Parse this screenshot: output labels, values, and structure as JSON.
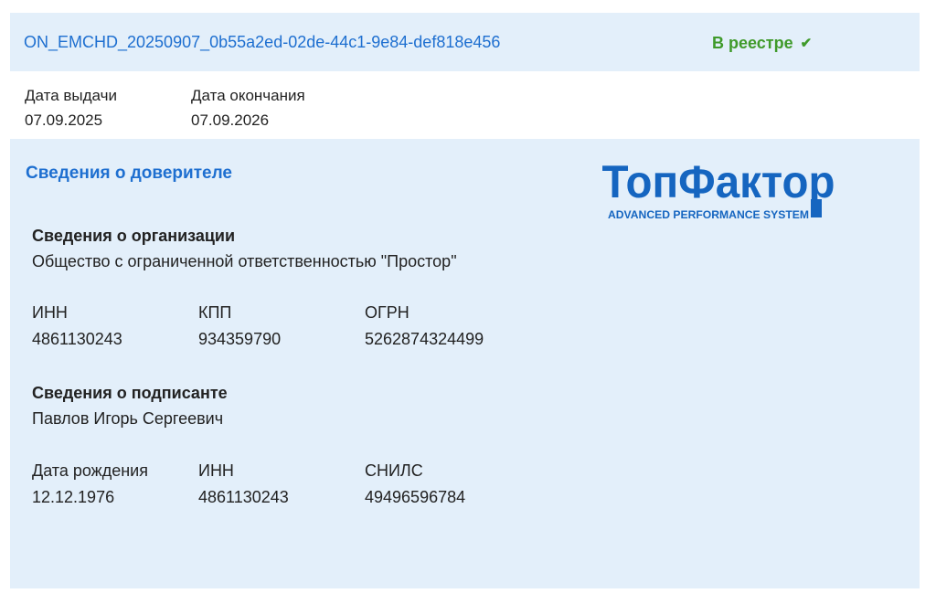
{
  "document": {
    "id": "ON_EMCHD_20250907_0b55a2ed-02de-44c1-9e84-def818e456",
    "status": "В реестре"
  },
  "dates": {
    "issue": {
      "label": "Дата выдачи",
      "value": "07.09.2025"
    },
    "expiry": {
      "label": "Дата окончания",
      "value": "07.09.2026"
    }
  },
  "principal": {
    "section_title": "Сведения о доверителе",
    "logo": {
      "name": "ТопФактор",
      "tagline": "ADVANCED PERFORMANCE SYSTEM",
      "color": "#1565c0"
    },
    "organization": {
      "title": "Сведения о организации",
      "name": "Общество с ограниченной ответственностью \"Простор\"",
      "inn": {
        "label": "ИНН",
        "value": "4861130243"
      },
      "kpp": {
        "label": "КПП",
        "value": "934359790"
      },
      "ogrn": {
        "label": "ОГРН",
        "value": "5262874324499"
      }
    },
    "signer": {
      "title": "Сведения о подписанте",
      "name": "Павлов Игорь Сергеевич",
      "birth_date": {
        "label": "Дата рождения",
        "value": "12.12.1976"
      },
      "inn": {
        "label": "ИНН",
        "value": "4861130243"
      },
      "snils": {
        "label": "СНИЛС",
        "value": "49496596784"
      }
    }
  },
  "colors": {
    "accent": "#1e6fd0",
    "status_ok": "#3f9a2a",
    "panel_bg": "#e3effa"
  },
  "icons": {
    "status": "check-icon"
  }
}
